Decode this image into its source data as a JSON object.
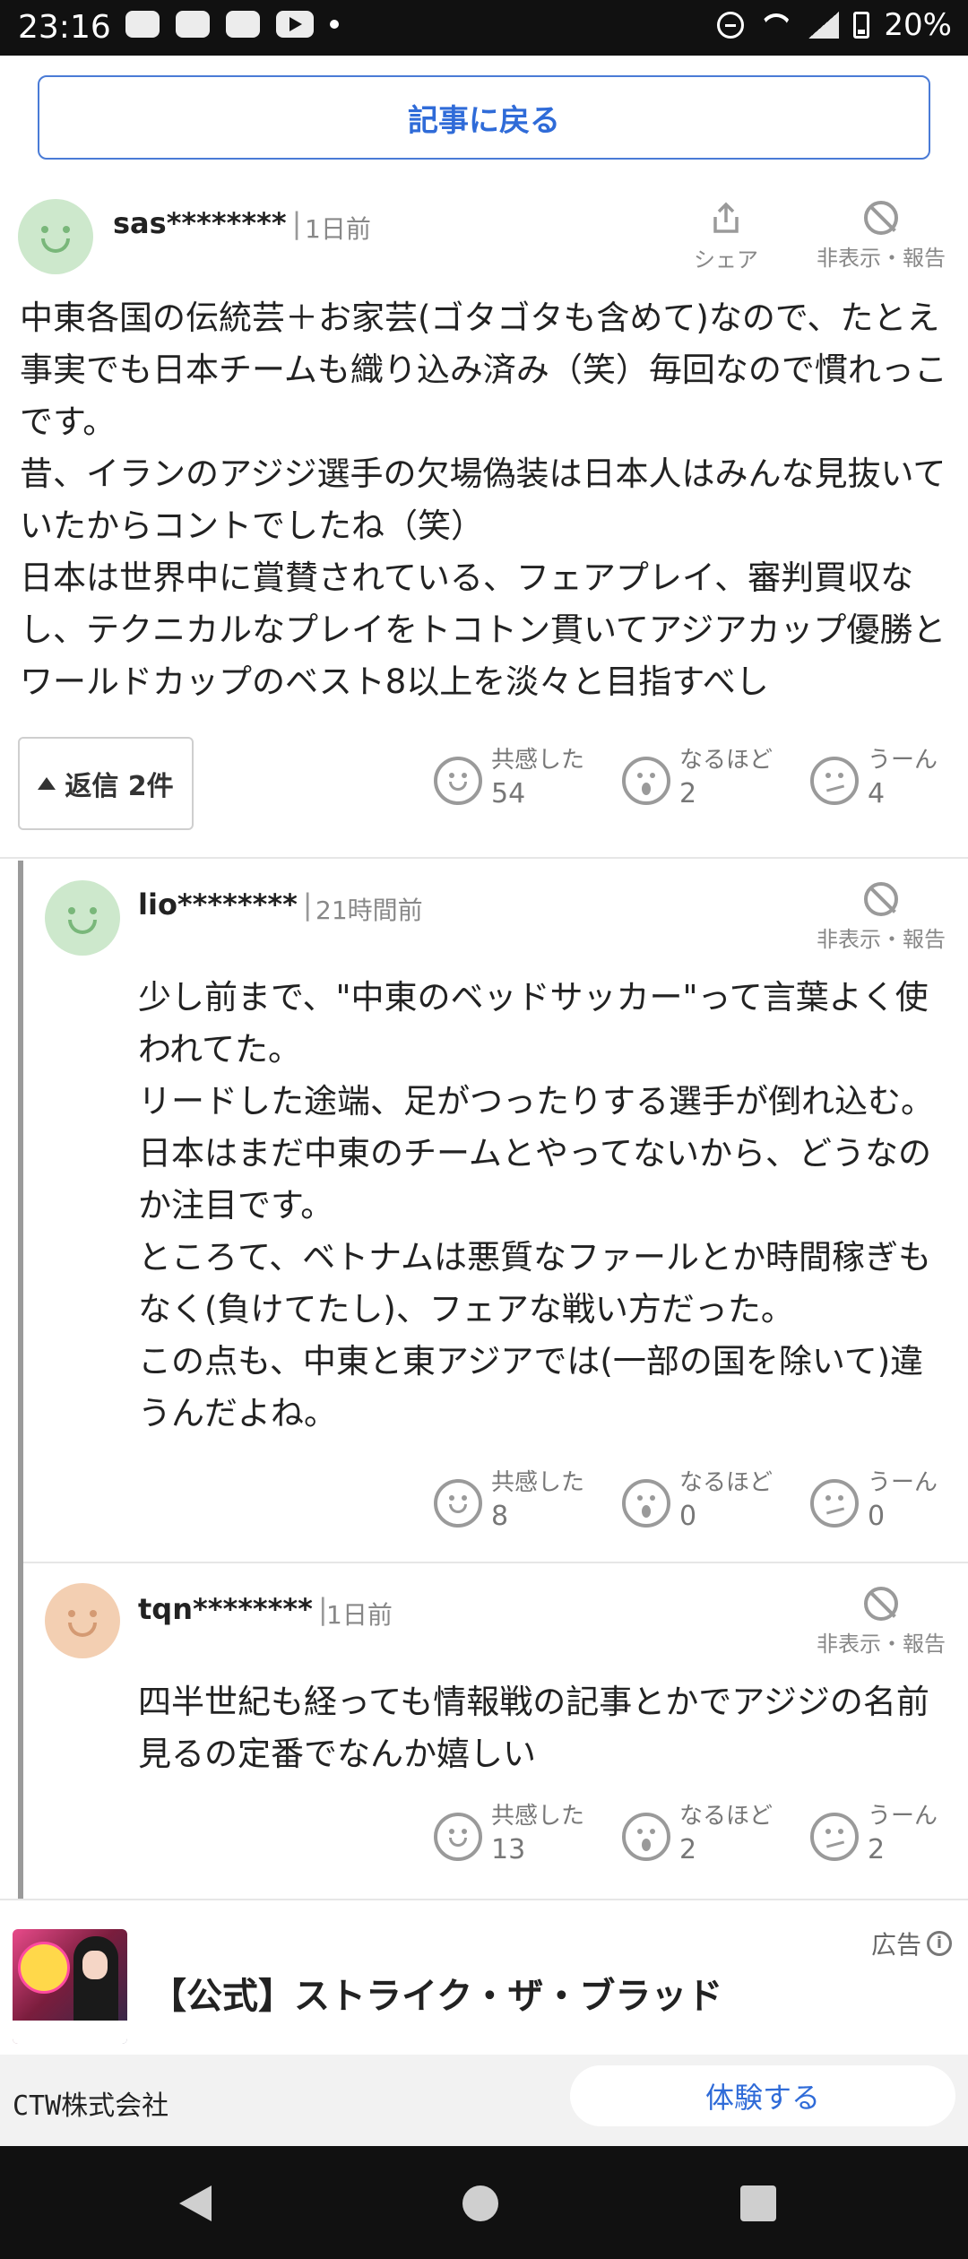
{
  "status_bar": {
    "time": "23:16",
    "battery": "20%",
    "network": "5"
  },
  "back_button": {
    "label": "記事に戻る"
  },
  "actions": {
    "share": "シェア",
    "hide_report": "非表示・報告"
  },
  "reaction_labels": {
    "agree": "共感した",
    "indeed": "なるほど",
    "hmm": "うーん"
  },
  "comments": [
    {
      "user": "sas********",
      "time": "1日前",
      "body": "中東各国の伝統芸＋お家芸(ゴタゴタも含めて)なので、たとえ事実でも日本チームも織り込み済み（笑）毎回なので慣れっこです。\n昔、イランのアジジ選手の欠場偽装は日本人はみんな見抜いていたからコントでしたね（笑）\n日本は世界中に賞賛されている、フェアプレイ、審判買収なし、テクニカルなプレイをトコトン貫いてアジアカップ優勝とワールドカップのベスト8以上を淡々と目指すべし",
      "replies_label": "返信 2件",
      "reactions": {
        "agree": "54",
        "indeed": "2",
        "hmm": "4"
      }
    },
    {
      "user": "lio********",
      "time": "21時間前",
      "body": "少し前まで、\"中東のベッドサッカー\"って言葉よく使われてた。\nリードした途端、足がつったりする選手が倒れ込む。日本はまだ中東のチームとやってないから、どうなのか注目です。\nところて、ベトナムは悪質なファールとか時間稼ぎもなく(負けてたし)、フェアな戦い方だった。\nこの点も、中東と東アジアでは(一部の国を除いて)違うんだよね。",
      "reactions": {
        "agree": "8",
        "indeed": "0",
        "hmm": "0"
      }
    },
    {
      "user": "tqn********",
      "time": "1日前",
      "body": "四半世紀も経っても情報戦の記事とかでアジジの名前見るの定番でなんか嬉しい",
      "reactions": {
        "agree": "13",
        "indeed": "2",
        "hmm": "2"
      }
    }
  ],
  "ad": {
    "label": "広告",
    "title": "【公式】ストライク・ザ・ブラッド",
    "company": "CTW株式会社",
    "cta": "体験する"
  },
  "colors": {
    "accent": "#2f6bd8",
    "muted": "#888888"
  }
}
